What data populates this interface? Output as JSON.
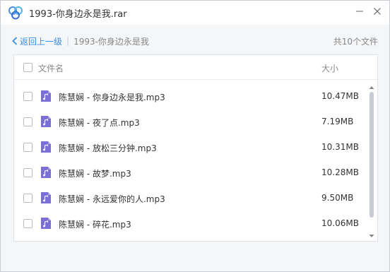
{
  "window": {
    "title": "1993-你身边永是我.rar",
    "accent_color": "#3a8ee6",
    "icon": "archive-app-icon"
  },
  "nav": {
    "back_label": "返回上一级",
    "separator": "|",
    "breadcrumb": "1993-你身边永是我",
    "file_count": "共10个文件"
  },
  "list": {
    "col_name": "文件名",
    "col_size": "大小",
    "file_icon_color": "#7b6fd6",
    "rows": [
      {
        "name": "陈慧娴 - 你身边永是我.mp3",
        "size": "10.47MB"
      },
      {
        "name": "陈慧娴 - 夜了点.mp3",
        "size": "7.19MB"
      },
      {
        "name": "陈慧娴 - 放松三分钟.mp3",
        "size": "10.31MB"
      },
      {
        "name": "陈慧娴 - 故梦.mp3",
        "size": "10.28MB"
      },
      {
        "name": "陈慧娴 - 永远爱你的人.mp3",
        "size": "9.50MB"
      },
      {
        "name": "陈慧娴 - 碎花.mp3",
        "size": "10.06MB"
      }
    ]
  }
}
